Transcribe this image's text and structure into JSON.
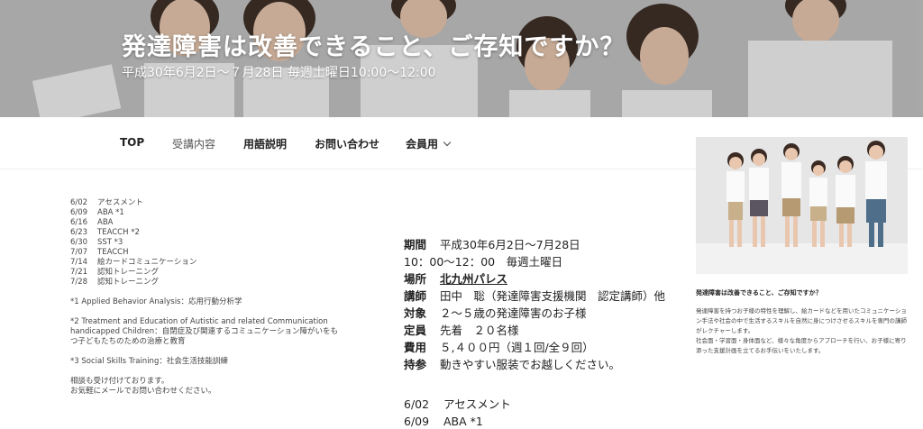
{
  "hero": {
    "title": "発達障害は改善できること、ご存知ですか？",
    "subtitle": "平成30年6月2日～７月28日 毎週土曜日10:00～12:00"
  },
  "nav": {
    "items": [
      {
        "label": "TOP",
        "active": true
      },
      {
        "label": "受講内容",
        "active": false
      },
      {
        "label": "用語説明",
        "active": false
      },
      {
        "label": "お問い合わせ",
        "active": false
      },
      {
        "label": "会員用",
        "active": false,
        "has_dropdown": true
      }
    ]
  },
  "schedule_small": [
    {
      "date": "6/02",
      "topic": "アセスメント"
    },
    {
      "date": "6/09",
      "topic": "ABA *1"
    },
    {
      "date": "6/16",
      "topic": "ABA"
    },
    {
      "date": "6/23",
      "topic": "TEACCH *2"
    },
    {
      "date": "6/30",
      "topic": "SST *3"
    },
    {
      "date": "7/07",
      "topic": "TEACCH"
    },
    {
      "date": "7/14",
      "topic": "絵カードコミュニケーション"
    },
    {
      "date": "7/21",
      "topic": "認知トレーニング"
    },
    {
      "date": "7/28",
      "topic": "認知トレーニング"
    }
  ],
  "footnotes": [
    "*1 Applied Behavior Analysis：応用行動分析学",
    "*2 Treatment and Education of Autistic and related Communication handicapped Children：自閉症及び関連するコミュニケーション障がいをもつ子どもたちのための治療と教育",
    "*3 Social Skills Training：社会生活技能訓練"
  ],
  "note": {
    "line1": "相談も受け付けております。",
    "line2": "お気軽にメールでお問い合わせください。"
  },
  "details": [
    {
      "key": "期間",
      "value": "平成30年6月2日～7月28日"
    },
    {
      "key": "",
      "value": "10：00～12：00　毎週土曜日"
    },
    {
      "key": "場所",
      "value": "北九州パレス",
      "emphasis": true
    },
    {
      "key": "講師",
      "value": "田中　聡（発達障害支援機関　認定講師）他"
    },
    {
      "key": "対象",
      "value": "２～５歳の発達障害のお子様"
    },
    {
      "key": "定員",
      "value": "先着　２０名様"
    },
    {
      "key": "費用",
      "value": "５,４００円（週１回/全９回）"
    },
    {
      "key": "持参",
      "value": "動きやすい服装でお越しください。"
    }
  ],
  "schedule_large": [
    {
      "date": "6/02",
      "topic": "アセスメント"
    },
    {
      "date": "6/09",
      "topic": "ABA *1"
    }
  ],
  "sidebar": {
    "title": "発達障害は改善できること、ご存知ですか？",
    "para1": "発達障害を持つお子様の特性を理解し、絵カードなどを用いたコミュニケーション手法や社会の中で生活するスキルを自然に身につけさせるスキルを専門の講師がレクチャーします。",
    "para2": "社会面・学習面・身体面など、様々な角度からアプローチを行い、お子様に寄り添った支援計画を立てるお手伝いをいたします。"
  },
  "colors": {
    "hero_text": "#ffffff",
    "nav_text": "#222222",
    "body_text": "#333333"
  }
}
